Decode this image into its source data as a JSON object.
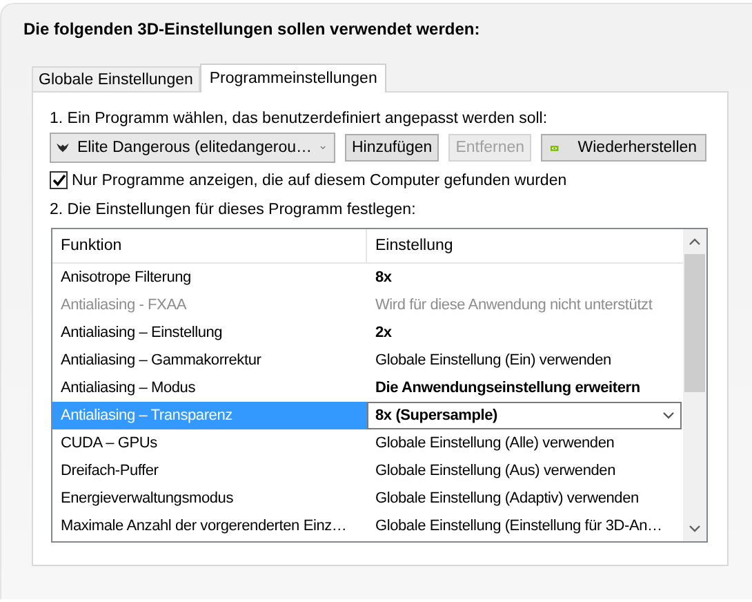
{
  "heading": "Die folgenden 3D-Einstellungen sollen verwendet werden:",
  "tabs": [
    {
      "label": "Globale Einstellungen",
      "selected": false
    },
    {
      "label": "Programmeinstellungen",
      "selected": true
    }
  ],
  "step_1": "1. Ein Programm wählen, das benutzerdefiniert angepasst werden soll:",
  "program_select": {
    "value": "Elite Dangerous (elitedangerou…"
  },
  "buttons": [
    {
      "label": "Hinzufügen",
      "disabled": false,
      "kind": "plain"
    },
    {
      "label": "Entfernen",
      "disabled": true,
      "kind": "plain"
    },
    {
      "label": "Wiederherstellen",
      "disabled": false,
      "kind": "logo"
    }
  ],
  "filter_checkbox": {
    "label": "Nur Programme anzeigen, die auf diesem Computer gefunden wurden",
    "checked": true
  },
  "step_2": "2. Die Einstellungen für dieses Programm festlegen:",
  "table": {
    "columns": [
      "Funktion",
      "Einstellung"
    ],
    "rows": [
      {
        "function": "Anisotrope Filterung",
        "setting": "8x",
        "disabled": false,
        "emphasized": true,
        "selected": false
      },
      {
        "function": "Antialiasing - FXAA",
        "setting": "Wird für diese Anwendung nicht unterstützt",
        "disabled": true,
        "emphasized": false,
        "selected": false
      },
      {
        "function": "Antialiasing – Einstellung",
        "setting": "2x",
        "disabled": false,
        "emphasized": true,
        "selected": false
      },
      {
        "function": "Antialiasing – Gammakorrektur",
        "setting": "Globale Einstellung (Ein) verwenden",
        "disabled": false,
        "emphasized": false,
        "selected": false
      },
      {
        "function": "Antialiasing – Modus",
        "setting": "Die Anwendungseinstellung erweitern",
        "disabled": false,
        "emphasized": true,
        "selected": false
      },
      {
        "function": "Antialiasing – Transparenz",
        "setting": "8x (Supersample)",
        "disabled": false,
        "emphasized": true,
        "selected": true
      },
      {
        "function": "CUDA – GPUs",
        "setting": "Globale Einstellung (Alle) verwenden",
        "disabled": false,
        "emphasized": false,
        "selected": false
      },
      {
        "function": "Dreifach-Puffer",
        "setting": "Globale Einstellung (Aus) verwenden",
        "disabled": false,
        "emphasized": false,
        "selected": false
      },
      {
        "function": "Energieverwaltungsmodus",
        "setting": "Globale Einstellung (Adaptiv) verwenden",
        "disabled": false,
        "emphasized": false,
        "selected": false
      },
      {
        "function": "Maximale Anzahl der vorgerenderten Einz…",
        "setting": "Globale Einstellung (Einstellung für 3D-An…",
        "disabled": false,
        "emphasized": false,
        "selected": false
      }
    ]
  }
}
